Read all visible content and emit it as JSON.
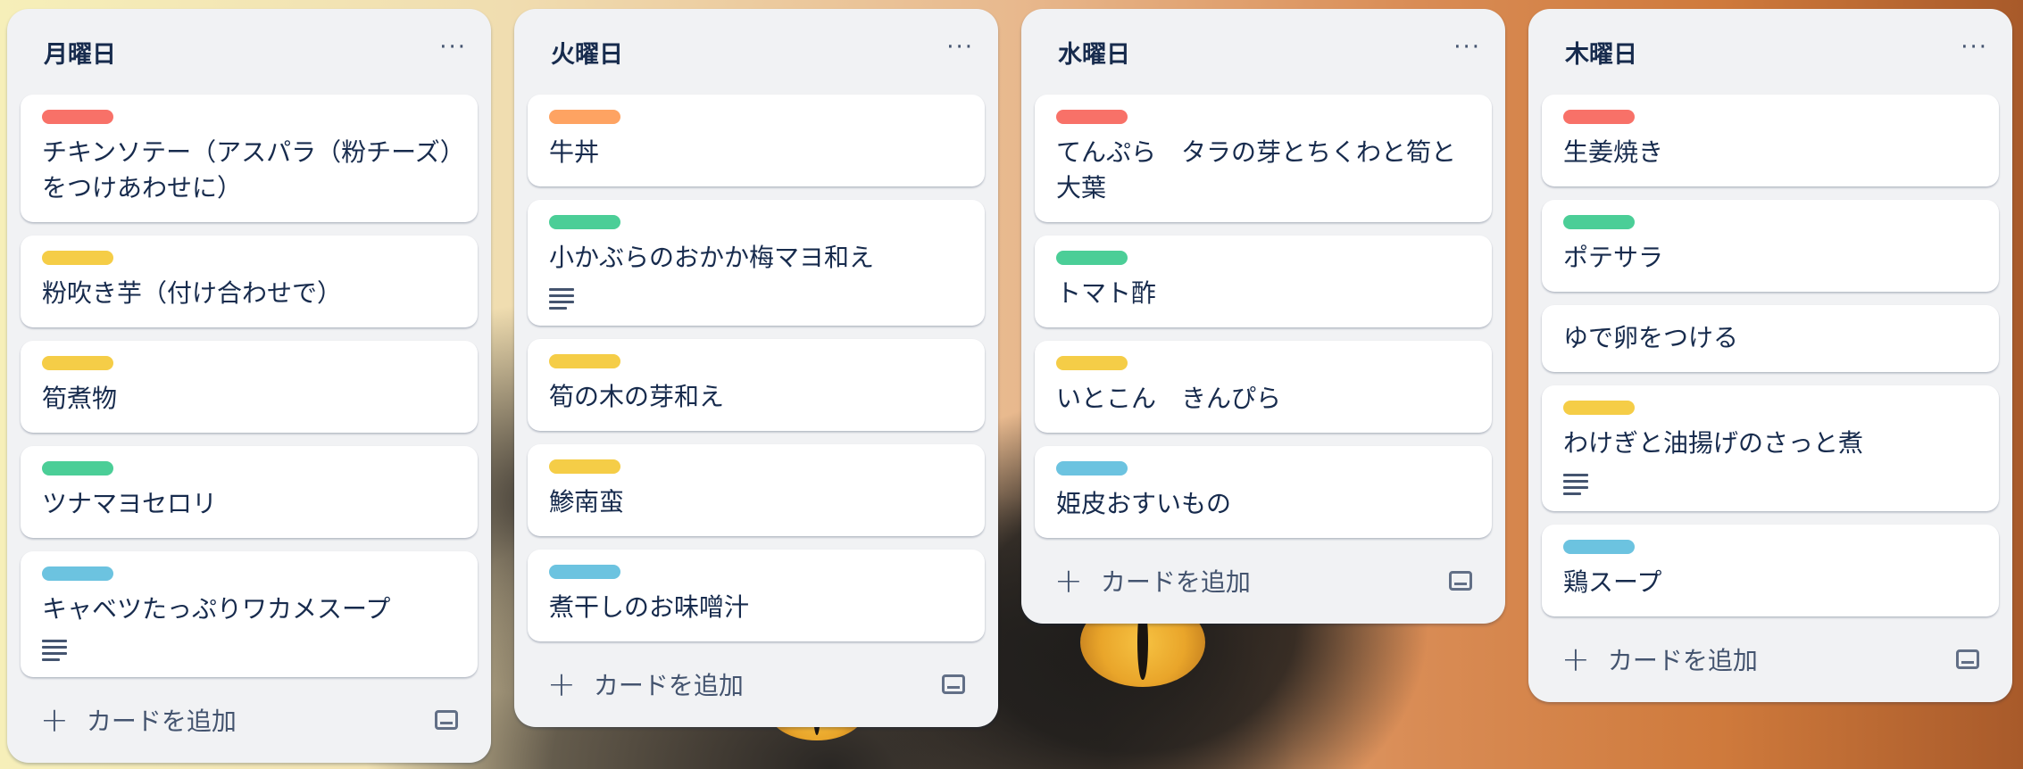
{
  "board": {
    "lists": [
      {
        "title": "月曜日",
        "cards": [
          {
            "label_color": "#f87168",
            "title": "チキンソテー（アスパラ（粉チーズ）をつけあわせに）",
            "has_description": false
          },
          {
            "label_color": "#f5cd47",
            "title": "粉吹き芋（付け合わせで）",
            "has_description": false
          },
          {
            "label_color": "#f5cd47",
            "title": "筍煮物",
            "has_description": false
          },
          {
            "label_color": "#4bce97",
            "title": "ツナマヨセロリ",
            "has_description": false
          },
          {
            "label_color": "#6cc3e0",
            "title": "キャベツたっぷりワカメスープ",
            "has_description": true
          }
        ],
        "add_card_label": "カードを追加"
      },
      {
        "title": "火曜日",
        "cards": [
          {
            "label_color": "#fea362",
            "title": "牛丼",
            "has_description": false
          },
          {
            "label_color": "#4bce97",
            "title": "小かぶらのおかか梅マヨ和え",
            "has_description": true
          },
          {
            "label_color": "#f5cd47",
            "title": "筍の木の芽和え",
            "has_description": false
          },
          {
            "label_color": "#f5cd47",
            "title": "鯵南蛮",
            "has_description": false
          },
          {
            "label_color": "#6cc3e0",
            "title": "煮干しのお味噌汁",
            "has_description": false
          }
        ],
        "add_card_label": "カードを追加"
      },
      {
        "title": "水曜日",
        "cards": [
          {
            "label_color": "#f87168",
            "title": "てんぷら　タラの芽とちくわと筍と大葉",
            "has_description": false
          },
          {
            "label_color": "#4bce97",
            "title": "トマト酢",
            "has_description": false
          },
          {
            "label_color": "#f5cd47",
            "title": "いとこん　きんぴら",
            "has_description": false
          },
          {
            "label_color": "#6cc3e0",
            "title": "姫皮おすいもの",
            "has_description": false
          }
        ],
        "add_card_label": "カードを追加"
      },
      {
        "title": "木曜日",
        "cards": [
          {
            "label_color": "#f87168",
            "title": "生姜焼き",
            "has_description": false
          },
          {
            "label_color": "#4bce97",
            "title": "ポテサラ",
            "has_description": false
          },
          {
            "label_color": null,
            "title": "ゆで卵をつける",
            "has_description": false
          },
          {
            "label_color": "#f5cd47",
            "title": "わけぎと油揚げのさっと煮",
            "has_description": true
          },
          {
            "label_color": "#6cc3e0",
            "title": "鶏スープ",
            "has_description": false
          }
        ],
        "add_card_label": "カードを追加"
      }
    ],
    "icons": {
      "list_menu": "more-horizontal-icon",
      "description": "description-icon",
      "add": "plus-icon",
      "template": "card-template-icon"
    },
    "menu_glyph": "···",
    "plus_glyph": "+"
  }
}
